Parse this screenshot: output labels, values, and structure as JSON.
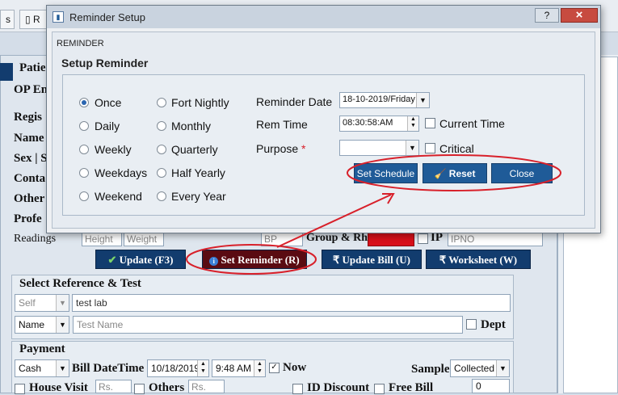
{
  "app": {
    "tabs": [
      "s",
      "R"
    ],
    "patient_heading": "Patie",
    "op_label": "OP En",
    "registration_label": "Regis",
    "name_label": "Name",
    "sex_label": "Sex | S",
    "contact_label": "Conta",
    "other_label": "Other",
    "profession_label": "Profe",
    "readings_label": "Readings",
    "height_placeholder": "Height",
    "weight_placeholder": "Weight",
    "bp_placeholder": "BP",
    "group_label": "Group & Rh",
    "ip_label": "IP",
    "ipno_placeholder": "IPNO",
    "update_btn": "Update (F3)",
    "set_reminder_btn": "Set Reminder (R)",
    "update_bill_btn": "Update Bill (U)",
    "worksheet_btn": "Worksheet (W)",
    "select_ref_heading": "Select Reference & Test",
    "ref_select": "Self",
    "ref_value": "test lab",
    "test_select": "Name",
    "test_placeholder": "Test Name",
    "dept_label": "Dept",
    "payment_heading": "Payment",
    "payment_mode": "Cash",
    "bill_datetime_label": "Bill DateTime",
    "bill_date": "10/18/2019",
    "bill_time": "9:48 AM",
    "now_label": "Now",
    "sample_label": "Sample",
    "sample_value": "Collected",
    "house_visit_label": "House Visit",
    "rs1_placeholder": "Rs.",
    "others_label": "Others",
    "rs2_placeholder": "Rs.",
    "id_discount_label": "ID Discount",
    "free_bill_label": "Free Bill",
    "amount_value": "0"
  },
  "dialog": {
    "title": "Reminder Setup",
    "help": "?",
    "close": "×",
    "caption": "REMINDER",
    "heading": "Setup Reminder",
    "frequencies_left": [
      "Once",
      "Daily",
      "Weekly",
      "Weekdays",
      "Weekend"
    ],
    "frequencies_right": [
      "Fort Nightly",
      "Monthly",
      "Quarterly",
      "Half Yearly",
      "Every Year"
    ],
    "selected_frequency": "Once",
    "reminder_date_label": "Reminder Date",
    "reminder_date_value": "18-10-2019/Friday",
    "rem_time_label": "Rem Time",
    "rem_time_value": "08:30:58:AM",
    "current_time_label": "Current Time",
    "purpose_label": "Purpose",
    "required_mark": "*",
    "purpose_value": "",
    "critical_label": "Critical",
    "set_schedule_btn": "Set Schedule",
    "reset_btn": "Reset",
    "close_btn": "Close"
  },
  "colors": {
    "annotation": "#d8202a",
    "button_blue": "#1f5b98",
    "button_dark": "#123c6e",
    "set_reminder_bg": "#5a0b12"
  }
}
